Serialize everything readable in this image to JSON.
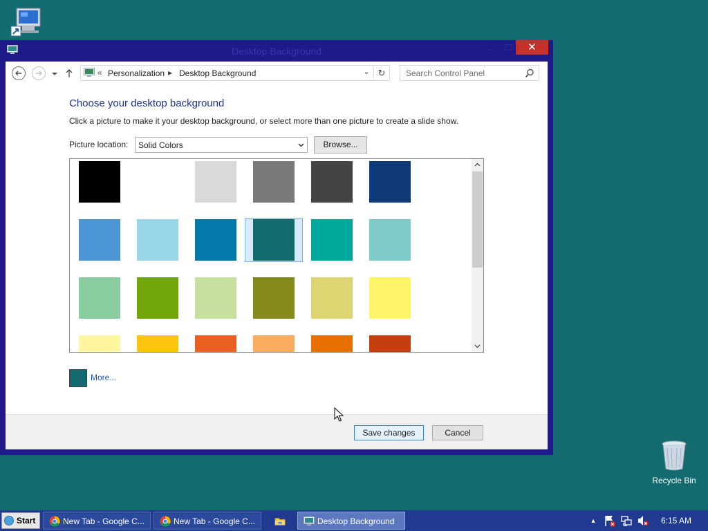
{
  "desktop": {
    "background_color": "#136b6f",
    "icons": [
      {
        "name": "computer-icon",
        "label": ""
      },
      {
        "name": "recycle-bin-icon",
        "label": "Recycle Bin"
      }
    ]
  },
  "window": {
    "title": "Desktop Background",
    "close_glyph": "✕",
    "frame_color": "#1e1a8a",
    "close_color": "#c7312b"
  },
  "navbar": {
    "chevron": "«",
    "breadcrumbs": [
      "Personalization",
      "Desktop Background"
    ],
    "separator_glyph": "▶",
    "dropdown_glyph": "⌄",
    "refresh_glyph": "↻",
    "search": {
      "placeholder": "Search Control Panel",
      "value": ""
    }
  },
  "content": {
    "heading": "Choose your desktop background",
    "subtext": "Click a picture to make it your desktop background, or select more than one picture to create a slide show.",
    "location_label": "Picture location:",
    "location_value": "Solid Colors",
    "browse_label": "Browse...",
    "selected_swatch": 9,
    "swatches": [
      "#000000",
      "#ffffff",
      "#d9d9d9",
      "#7a7a7a",
      "#444444",
      "#0e3a7a",
      "#4a96d4",
      "#99d6ea",
      "#0478a9",
      "#136b6f",
      "#00a89c",
      "#7dcbc9",
      "#88cc9f",
      "#72a60d",
      "#c7e09e",
      "#858a1c",
      "#dcd571",
      "#fef467",
      "#fff6a0",
      "#fcc40f",
      "#ea6020",
      "#fbab5e",
      "#e76f00",
      "#c53e0d"
    ],
    "more_label": "More...",
    "current_color": "#136b6f"
  },
  "footer": {
    "save_label": "Save changes",
    "cancel_label": "Cancel"
  },
  "taskbar": {
    "start_label": "Start",
    "buttons": [
      {
        "label": "New Tab - Google C...",
        "icon": "chrome-icon"
      },
      {
        "label": "New Tab - Google C...",
        "icon": "chrome-icon"
      },
      {
        "label": "",
        "icon": "folder-icon"
      },
      {
        "label": "Desktop Background",
        "icon": "display-settings-icon",
        "active": true
      }
    ],
    "tray_arrow": "▲",
    "clock": "6:15 AM"
  }
}
